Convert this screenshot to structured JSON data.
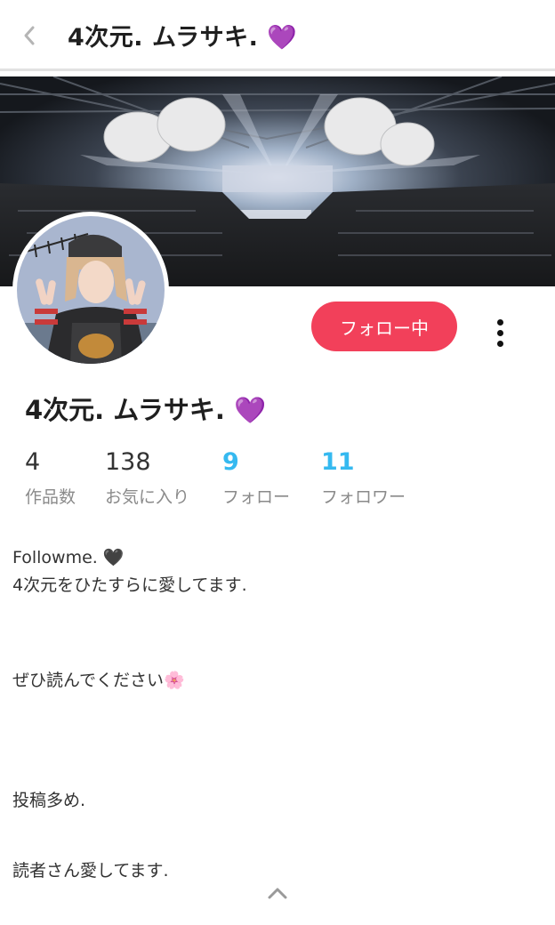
{
  "header": {
    "title": "4次元.  ムラサキ.  💜"
  },
  "profile": {
    "name": "4次元.  ムラサキ.  💜",
    "follow_button": "フォロー中"
  },
  "stats": [
    {
      "value": "4",
      "label": "作品数"
    },
    {
      "value": "138",
      "label": "お気に入り"
    },
    {
      "value": "9",
      "label": "フォロー"
    },
    {
      "value": "11",
      "label": "フォロワー"
    }
  ],
  "bio": {
    "line1": "Followme.  🖤",
    "line2": "4次元をひたすらに愛してます.",
    "line3": "ぜひ読んでください🌸",
    "line4": "投稿多め.",
    "line5": "読者さん愛してます."
  },
  "colors": {
    "accent": "#f2405a",
    "link_blue": "#35b9f0",
    "muted": "#8a8a8a"
  },
  "icons": {
    "back": "chevron-left-icon",
    "more": "more-vertical-icon",
    "scroll_top": "chevron-up-icon"
  }
}
